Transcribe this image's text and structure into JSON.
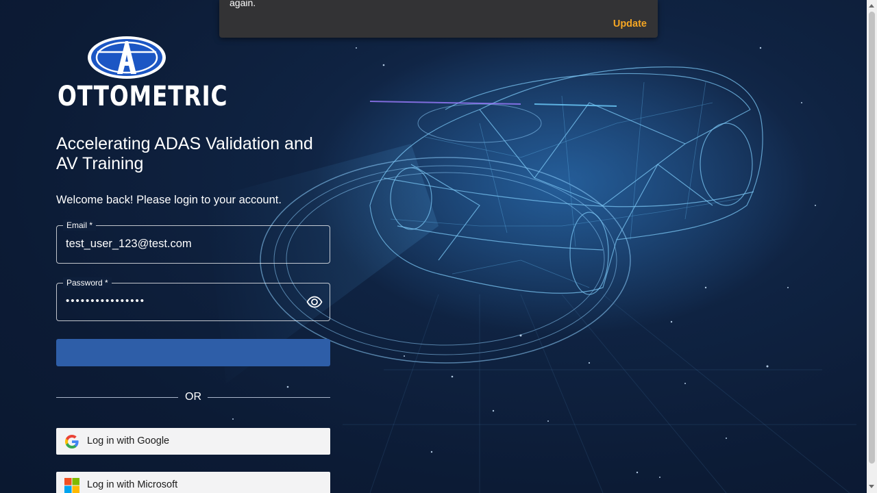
{
  "brand": {
    "name": "OTTOMETRIC",
    "tagline": "Accelerating ADAS Validation and AV Training"
  },
  "login": {
    "welcome": "Welcome back! Please login to your account.",
    "email_label": "Email *",
    "email_value": "test_user_123@test.com",
    "password_label": "Password *",
    "password_masked": "••••••••••••••••",
    "divider_text": "OR",
    "google_label": "Log in with Google",
    "microsoft_label": "Log in with Microsoft"
  },
  "toast": {
    "message": "again.",
    "action_label": "Update"
  },
  "colors": {
    "background": "#0c1b35",
    "primary_button": "#2e5ea8",
    "toast_background": "#333335",
    "toast_action": "#f5a623"
  },
  "icons": {
    "password_toggle": "eye-icon",
    "google": "google-icon",
    "microsoft": "microsoft-icon"
  }
}
